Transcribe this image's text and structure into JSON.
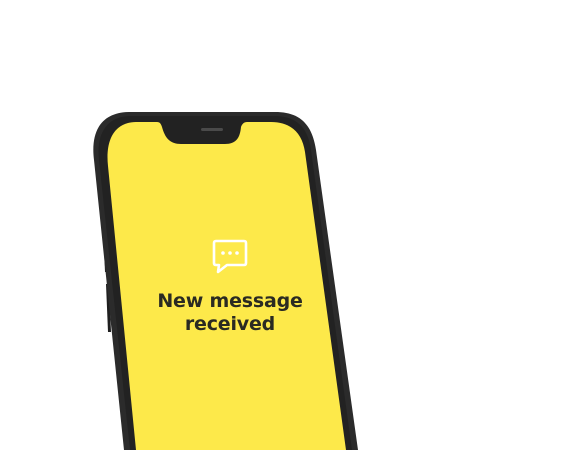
{
  "notification": {
    "line1": "New message",
    "line2": "received",
    "icon": "chat-bubble-icon"
  },
  "colors": {
    "screen": "#fde94a",
    "frame": "#2b2b2b",
    "text": "#2a2a22",
    "icon": "#ffffff"
  }
}
